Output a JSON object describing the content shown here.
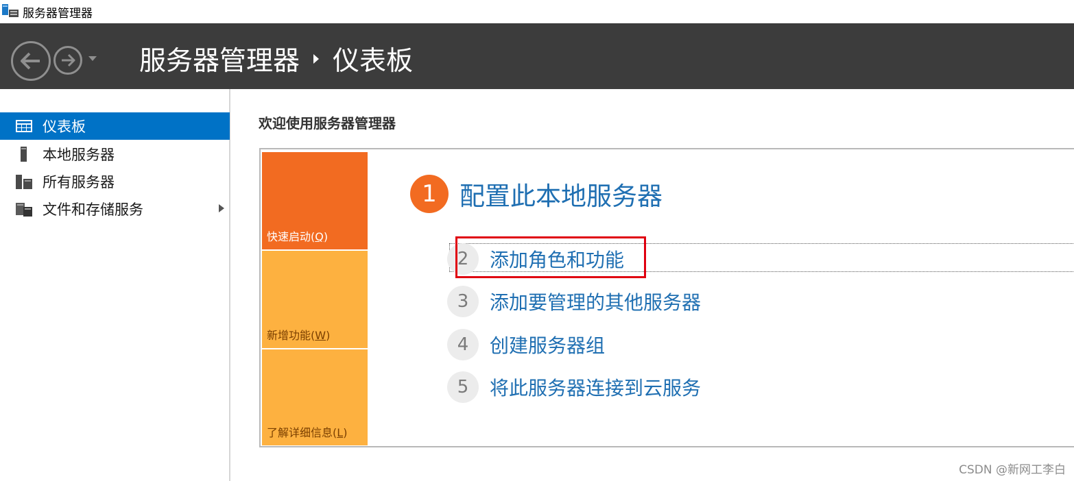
{
  "window": {
    "title": "服务器管理器",
    "app_icon": "server-manager-icon"
  },
  "header": {
    "back_icon": "back-arrow-icon",
    "forward_icon": "forward-arrow-icon",
    "dropdown_icon": "chevron-down-icon",
    "breadcrumb": [
      "服务器管理器",
      "仪表板"
    ]
  },
  "sidebar": {
    "items": [
      {
        "label": "仪表板",
        "icon": "dashboard-icon",
        "active": true
      },
      {
        "label": "本地服务器",
        "icon": "local-server-icon",
        "active": false
      },
      {
        "label": "所有服务器",
        "icon": "all-servers-icon",
        "active": false
      },
      {
        "label": "文件和存储服务",
        "icon": "file-storage-icon",
        "active": false,
        "has_children": true
      }
    ]
  },
  "main": {
    "welcome_title": "欢迎使用服务器管理器",
    "tiles": [
      {
        "label": "快速启动",
        "accesskey": "Q",
        "color": "#f26b21"
      },
      {
        "label": "新增功能",
        "accesskey": "W",
        "color": "#fdb140"
      },
      {
        "label": "了解详细信息",
        "accesskey": "L",
        "color": "#fdb140"
      }
    ],
    "primary_step": {
      "number": "1",
      "title": "配置此本地服务器"
    },
    "steps": [
      {
        "number": "2",
        "label": "添加角色和功能",
        "highlighted": true
      },
      {
        "number": "3",
        "label": "添加要管理的其他服务器"
      },
      {
        "number": "4",
        "label": "创建服务器组"
      },
      {
        "number": "5",
        "label": "将此服务器连接到云服务"
      }
    ]
  },
  "colors": {
    "header_bg": "#3c3c3c",
    "active_nav": "#0072c6",
    "link_blue": "#1f6fb2",
    "orange": "#f26b21",
    "light_orange": "#fdb140",
    "highlight_red": "#e0000f"
  },
  "watermark": "CSDN @新网工李白"
}
